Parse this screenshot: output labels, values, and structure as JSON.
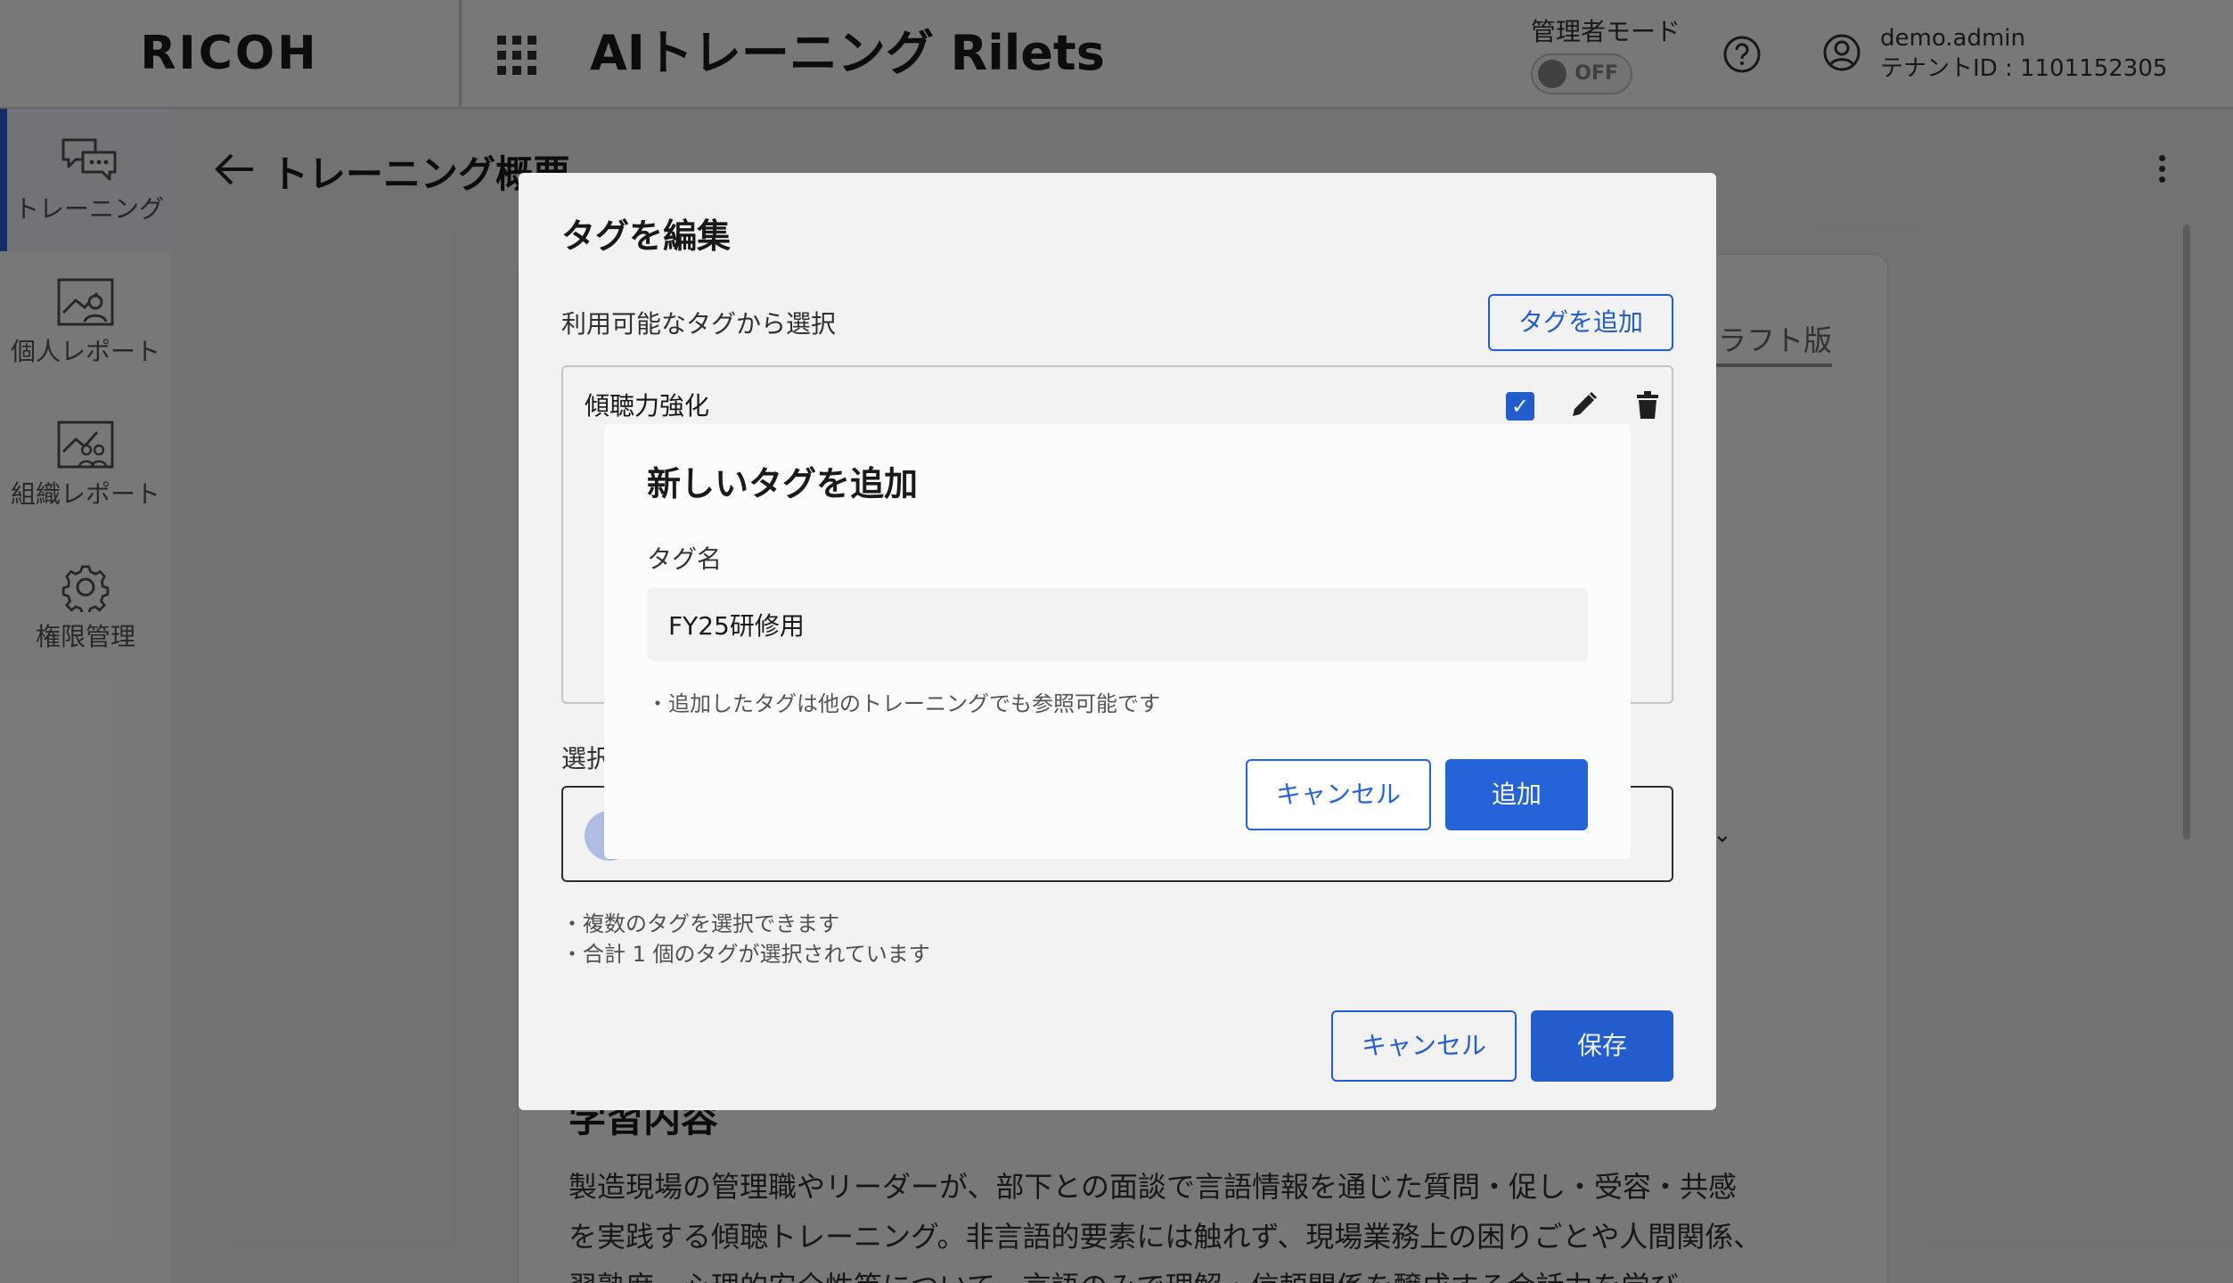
{
  "header": {
    "logo": "RICOH",
    "apps_icon": "grid-icon",
    "app_title": "AIトレーニング Rilets",
    "admin_mode_label": "管理者モード",
    "admin_toggle_state": "OFF",
    "help_icon": "help-circle-icon",
    "user_icon": "user-circle-icon",
    "user_name": "demo.admin",
    "tenant_id": "テナントID : 1101152305"
  },
  "sidebar": {
    "items": [
      {
        "label": "トレーニング",
        "icon": "chat-bubbles-icon",
        "active": true
      },
      {
        "label": "個人レポート",
        "icon": "person-report-icon",
        "active": false
      },
      {
        "label": "組織レポート",
        "icon": "org-report-icon",
        "active": false
      },
      {
        "label": "権限管理",
        "icon": "gear-icon",
        "active": false
      }
    ]
  },
  "page": {
    "title": "トレーニング概要",
    "draft_tab": "ラフト版",
    "learning_heading": "学習内容",
    "learning_body": "製造現場の管理職やリーダーが、部下との面談で言語情報を通じた質問・促し・受容・共感を実践する傾聴トレーニング。非言語的要素には触れず、現場業務上の困りごとや人間関係、習熟度、心理的安全性等について、言語のみで理解・信頼関係を醸成する会話力を学び"
  },
  "edit_tags_dialog": {
    "title": "タグを編集",
    "available_label": "利用可能なタグから選択",
    "add_tag_button": "タグを追加",
    "tags": [
      {
        "name": "傾聴力強化",
        "checked": true
      }
    ],
    "selected_label": "選択",
    "notes": [
      "・複数のタグを選択できます",
      "・合計 1 個のタグが選択されています"
    ],
    "cancel_button": "キャンセル",
    "save_button": "保存"
  },
  "add_tag_dialog": {
    "title": "新しいタグを追加",
    "field_label": "タグ名",
    "field_value": "FY25研修用",
    "hint": "・追加したタグは他のトレーニングでも参照可能です",
    "cancel_button": "キャンセル",
    "add_button": "追加"
  },
  "colors": {
    "accent": "#2563d9",
    "overlay": "rgba(0,0,0,0.5)"
  }
}
